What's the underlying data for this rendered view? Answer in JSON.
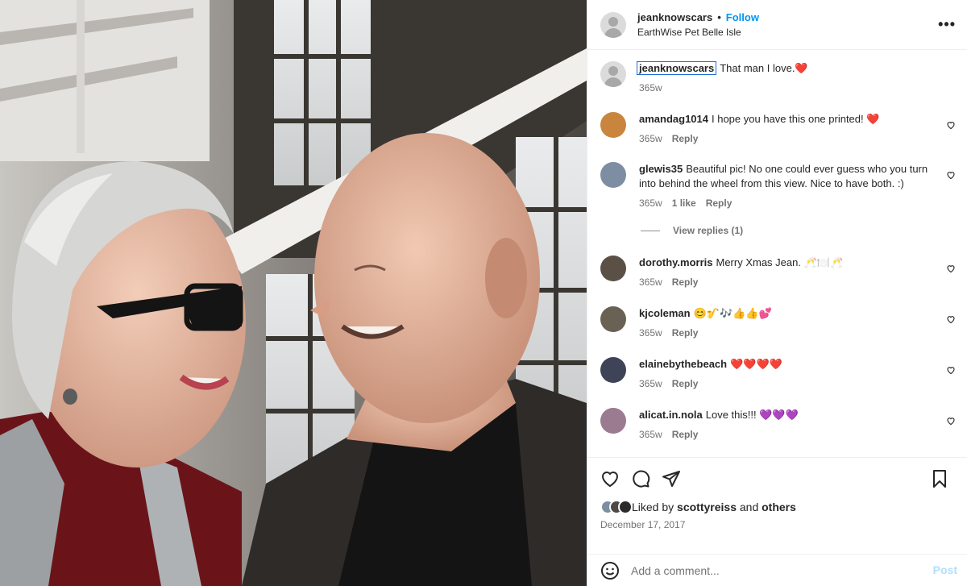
{
  "post": {
    "username": "jeanknowscars",
    "follow_label": "Follow",
    "separator": "•",
    "location": "EarthWise Pet Belle Isle",
    "more_label": "•••"
  },
  "caption": {
    "username": "jeanknowscars",
    "text": "That man I love.❤️",
    "time": "365w"
  },
  "comments": [
    {
      "username": "amandag1014",
      "text": "I hope you have this one printed! ❤️",
      "time": "365w",
      "likes": "",
      "reply": "Reply",
      "avatar_color": "#c9853e"
    },
    {
      "username": "glewis35",
      "text": "Beautiful pic! No one could ever guess who you turn into behind the wheel from this view. Nice to have both. :)",
      "time": "365w",
      "likes": "1 like",
      "reply": "Reply",
      "avatar_color": "#7d8ea3",
      "view_replies": "View replies (1)"
    },
    {
      "username": "dorothy.morris",
      "text": "Merry Xmas Jean. 🥂🍽️🥂",
      "time": "365w",
      "likes": "",
      "reply": "Reply",
      "avatar_color": "#5b5046"
    },
    {
      "username": "kjcoleman",
      "text": "😊🎷🎶👍👍💕",
      "time": "365w",
      "likes": "",
      "reply": "Reply",
      "avatar_color": "#6a6155"
    },
    {
      "username": "elainebythebeach",
      "text": "❤️❤️❤️❤️",
      "time": "365w",
      "likes": "",
      "reply": "Reply",
      "avatar_color": "#3e4358"
    },
    {
      "username": "alicat.in.nola",
      "text": "Love this!!! 💜💜💜",
      "time": "365w",
      "likes": "",
      "reply": "Reply",
      "avatar_color": "#9a7b8f"
    }
  ],
  "actions": {
    "icons": [
      "heart-icon",
      "comment-icon",
      "share-icon",
      "bookmark-icon"
    ],
    "liked_prefix": "Liked by",
    "liked_user": "scottyreiss",
    "liked_and": "and",
    "liked_others": "others",
    "date": "December 17, 2017"
  },
  "add_comment": {
    "placeholder": "Add a comment...",
    "post_label": "Post"
  },
  "colors": {
    "link": "#0095f6",
    "muted": "#737373",
    "post_disabled": "#b2dffc"
  }
}
